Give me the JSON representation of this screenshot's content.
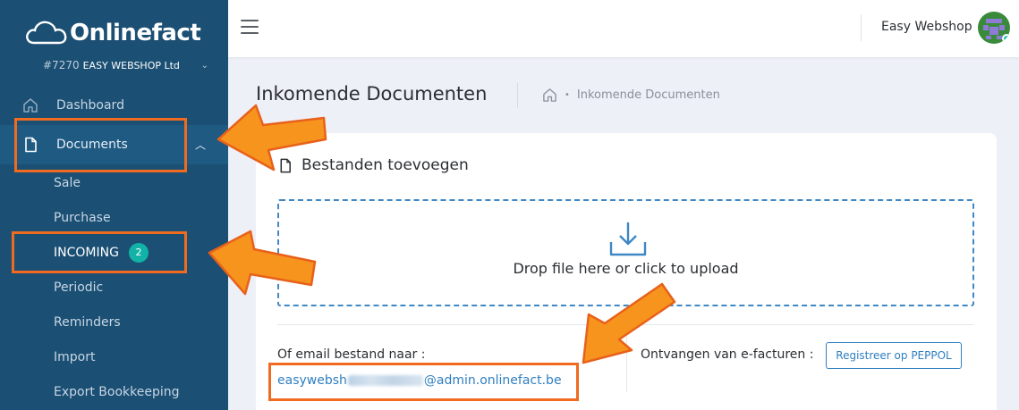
{
  "brand": {
    "logo_text": "Onlinefact"
  },
  "company": {
    "number": "#7270",
    "name": "EASY WEBSHOP Ltd"
  },
  "sidebar": {
    "dashboard": "Dashboard",
    "documents": "Documents",
    "sub_items": [
      {
        "label": "Sale"
      },
      {
        "label": "Purchase"
      },
      {
        "label": "INCOMING",
        "badge": "2"
      },
      {
        "label": "Periodic"
      },
      {
        "label": "Reminders"
      },
      {
        "label": "Import"
      },
      {
        "label": "Export Bookkeeping"
      }
    ]
  },
  "header": {
    "user_name": "Easy Webshop"
  },
  "page": {
    "title": "Inkomende Documenten",
    "breadcrumb": "Inkomende Documenten"
  },
  "card": {
    "title": "Bestanden toevoegen",
    "dropzone_text": "Drop file here or click to upload",
    "email_label": "Of email bestand naar :",
    "email_prefix": "easywebsh",
    "email_suffix": "@admin.onlinefact.be",
    "peppol_label": "Ontvangen van e-facturen :",
    "peppol_button": "Registreer op PEPPOL"
  },
  "colors": {
    "sidebar": "#1b4f73",
    "accent": "#2f7fc1",
    "badge": "#12b3a6",
    "annotation": "#f7941d"
  },
  "icons": {
    "logo": "cloud-icon",
    "dashboard": "home-icon",
    "documents": "file-icon",
    "upload": "download-tray-icon",
    "breadcrumb_home": "home-icon",
    "menu": "hamburger-icon"
  }
}
